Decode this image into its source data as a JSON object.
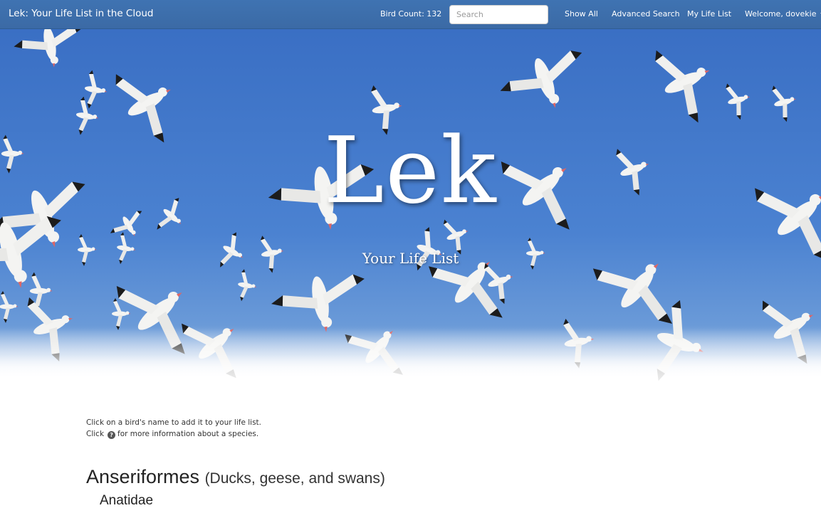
{
  "navbar": {
    "brand": "Lek: Your Life List in the Cloud",
    "bird_count": "Bird Count: 132",
    "search_placeholder": "Search",
    "search_value": "",
    "show_all": "Show All",
    "advanced_search": "Advanced Search",
    "my_life_list": "My Life List",
    "welcome": "Welcome, dovekie"
  },
  "hero": {
    "title": "Lek",
    "subtitle": "Your Life List"
  },
  "instructions": {
    "line1": "Click on a bird's name to add it to your life list.",
    "line2_before": "Click",
    "line2_icon": "question-circle-icon",
    "line2_after": "for more information about a species."
  },
  "taxonomy": {
    "order_name": "Anseriformes",
    "order_common": "(Ducks, geese, and swans)",
    "family_name": "Anatidae"
  },
  "colors": {
    "navbar": "#3b6aa5",
    "sky": "#4b82d1"
  }
}
